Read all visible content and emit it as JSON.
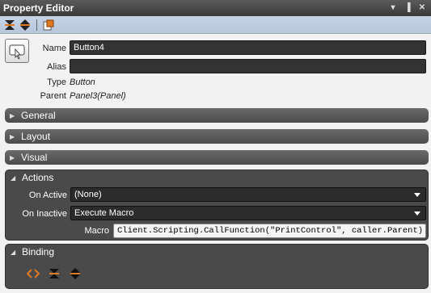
{
  "window": {
    "title": "Property Editor"
  },
  "titlebar_buttons": {
    "menu": "▾",
    "pin": "▐",
    "close": "✕"
  },
  "identity": {
    "name_label": "Name",
    "name_value": "Button4",
    "alias_label": "Alias",
    "alias_value": "",
    "type_label": "Type",
    "type_value": "Button",
    "parent_label": "Parent",
    "parent_value": "Panel3(Panel)"
  },
  "sections": {
    "general": "General",
    "layout": "Layout",
    "visual": "Visual",
    "actions": "Actions",
    "binding": "Binding"
  },
  "actions": {
    "on_active_label": "On Active",
    "on_active_value": "(None)",
    "on_inactive_label": "On Inactive",
    "on_inactive_value": "Execute Macro",
    "macro_label": "Macro",
    "macro_value": "Client.Scripting.CallFunction(\"PrintControl\", caller.Parent)"
  },
  "colors": {
    "accent": "#e07a20",
    "section_bg": "#4c4c4c"
  }
}
